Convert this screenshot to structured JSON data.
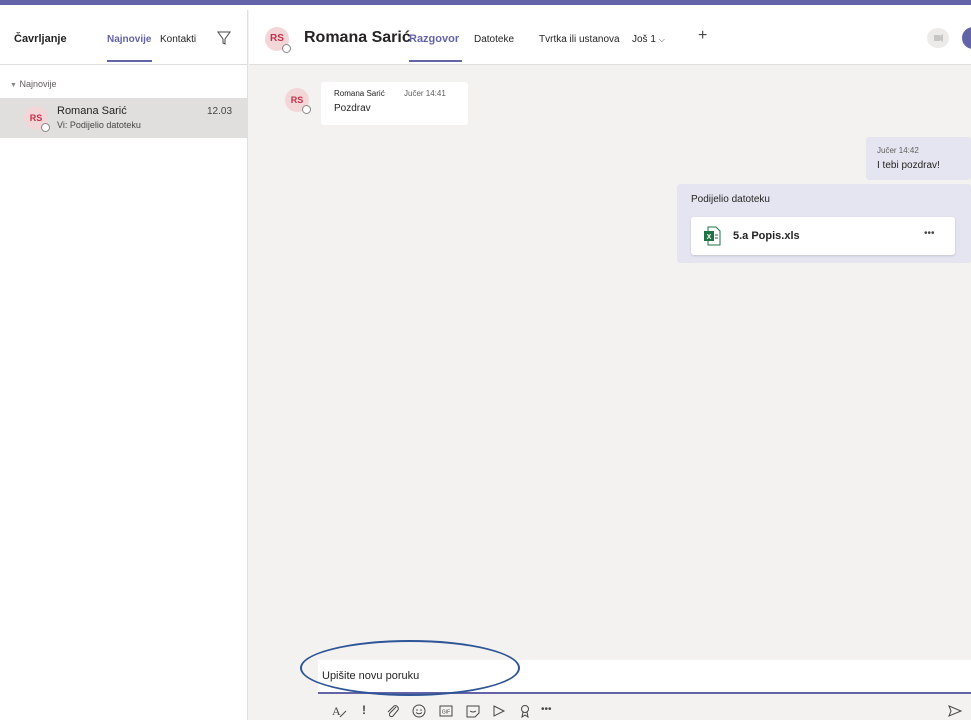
{
  "sidebar": {
    "title": "Čavrljanje",
    "tab_recent": "Najnovije",
    "tab_contacts": "Kontakti",
    "section_label": "Najnovije",
    "chat": {
      "initials": "RS",
      "name": "Romana Sarić",
      "preview": "Vi: Podijelio datoteku",
      "time": "12.03"
    }
  },
  "header": {
    "initials": "RS",
    "name": "Romana Sarić",
    "tabs": [
      "Razgovor",
      "Datoteke",
      "Tvrtka ili ustanova",
      "Još 1"
    ],
    "add_tab": "+"
  },
  "messages": {
    "incoming": {
      "initials": "RS",
      "author": "Romana Sarić",
      "time": "Jučer 14:41",
      "text": "Pozdrav"
    },
    "outgoing": {
      "time": "Jučer 14:42",
      "text": "I tebi pozdrav!"
    },
    "file_share": {
      "label": "Podijelio datoteku",
      "file_name": "5.a Popis.xls",
      "more": "•••"
    }
  },
  "composer": {
    "placeholder": "Upišite novu poruku",
    "tools": [
      "format",
      "important",
      "attach",
      "emoji",
      "gif",
      "sticker",
      "meet-now",
      "praise",
      "more"
    ]
  },
  "colors": {
    "accent": "#6264a7",
    "avatar_bg": "#f3d6d8",
    "avatar_fg": "#c4314b",
    "excel": "#217346",
    "annotation": "#2f5597"
  }
}
